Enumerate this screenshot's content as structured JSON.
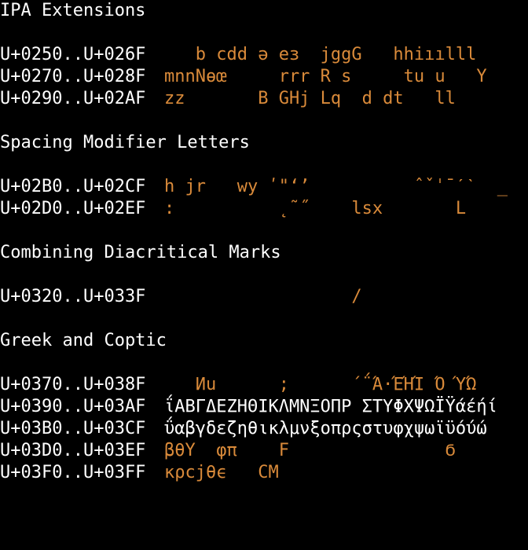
{
  "colors": {
    "background": "#000000",
    "text": "#ffffff",
    "glyph_accent": "#d98a3a"
  },
  "sections": [
    {
      "heading": "IPA Extensions",
      "rows": [
        {
          "range": "U+0250..U+026F",
          "glyphs": "   b cdd ə eɜ  jggG   hhiıılll"
        },
        {
          "range": "U+0270..U+028F",
          "glyphs": "mnnNɵœ     rrr R s     tu u   Y"
        },
        {
          "range": "U+0290..U+02AF",
          "glyphs": "zz       B GHj Lq  d dt   ll"
        }
      ]
    },
    {
      "heading": "Spacing Modifier Letters",
      "rows": [
        {
          "range": "U+02B0..U+02CF",
          "glyphs": "h jr   wy ʹ\"ʻʼ          ˆˇˈˉˊˋ  _"
        },
        {
          "range": "U+02D0..U+02EF",
          "glyphs": ":          ˛˜˝    lsx       L"
        }
      ]
    },
    {
      "heading": "Combining Diacritical Marks",
      "rows": [
        {
          "range": "U+0320..U+033F",
          "glyphs": "                  /"
        }
      ]
    },
    {
      "heading": "Greek and Coptic",
      "rows": [
        {
          "range": "U+0370..U+038F",
          "glyphs": "   Ͷu      ;      ΄΅Ά·ΈΉΊ Ό ΎΏ"
        },
        {
          "range": "U+0390..U+03AF",
          "glyphs": "ΐΑΒΓΔΕΖΗΘΙΚΛΜΝΞΟΠΡ ΣΤΥΦΧΨΩΪΫάέήί"
        },
        {
          "range": "U+03B0..U+03CF",
          "glyphs": "ΰαβγδεζηθικλμνξοπρςστυφχψωϊϋόύώ"
        },
        {
          "range": "U+03D0..U+03EF",
          "glyphs": "βθY  φπ    F               Ϭ"
        },
        {
          "range": "U+03F0..U+03FF",
          "glyphs": "κρcjθϵ   CM"
        }
      ]
    }
  ]
}
